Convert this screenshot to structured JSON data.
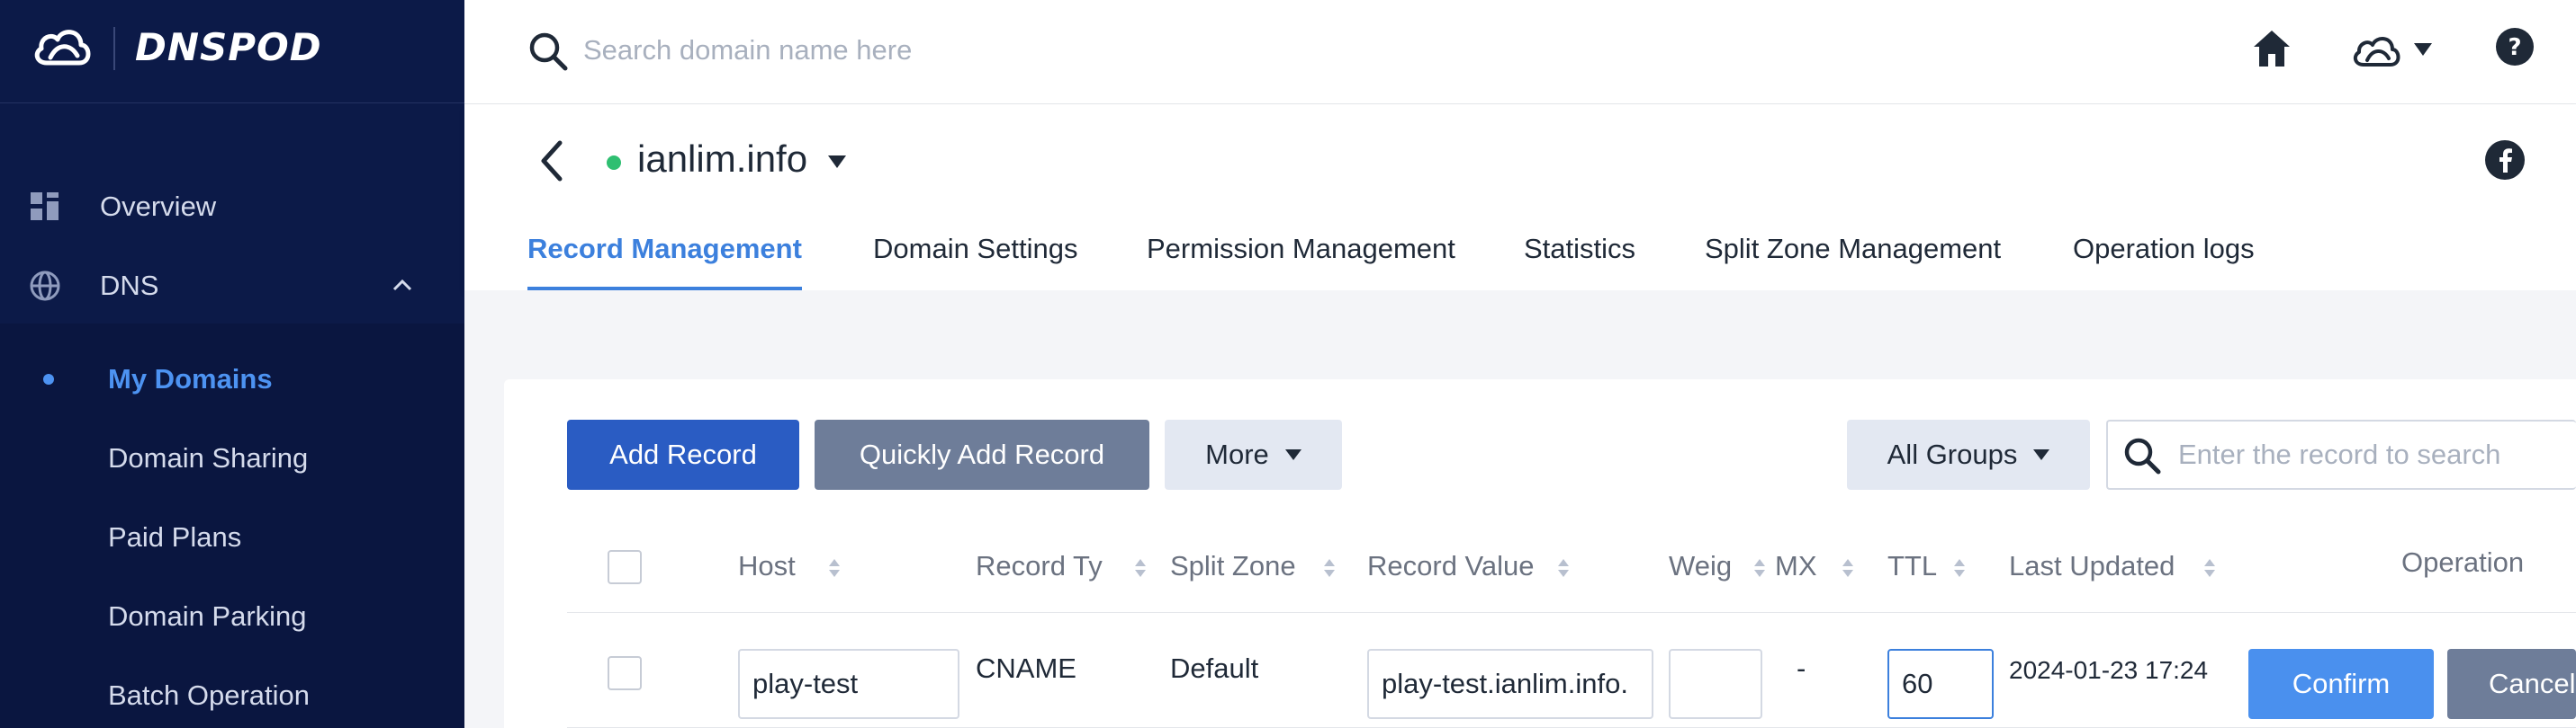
{
  "brand": {
    "name": "DNSPOD"
  },
  "sidebar": {
    "items": [
      {
        "label": "Overview",
        "icon": "grid-icon"
      },
      {
        "label": "DNS",
        "icon": "globe-icon"
      }
    ],
    "subitems": [
      {
        "label": "My Domains",
        "active": true
      },
      {
        "label": "Domain Sharing"
      },
      {
        "label": "Paid Plans"
      },
      {
        "label": "Domain Parking"
      },
      {
        "label": "Batch Operation"
      }
    ]
  },
  "topbar": {
    "search_placeholder": "Search domain name here",
    "icons": [
      "search-icon",
      "home-icon",
      "cloud-icon",
      "help-icon"
    ]
  },
  "domain": {
    "name": "ianlim.info",
    "status_color": "#2fbf71"
  },
  "tabs": [
    {
      "label": "Record Management",
      "active": true
    },
    {
      "label": "Domain Settings"
    },
    {
      "label": "Permission Management"
    },
    {
      "label": "Statistics"
    },
    {
      "label": "Split Zone Management"
    },
    {
      "label": "Operation logs"
    }
  ],
  "toolbar": {
    "add_record": "Add Record",
    "quick_add": "Quickly Add Record",
    "more": "More",
    "groups": "All Groups",
    "record_search_placeholder": "Enter the record to search"
  },
  "table": {
    "headers": {
      "host": "Host",
      "record_type": "Record Ty",
      "split_zone": "Split Zone",
      "record_value": "Record Value",
      "weight": "Weig",
      "mx": "MX",
      "ttl": "TTL",
      "last_updated": "Last Updated",
      "operation": "Operation"
    },
    "rows": [
      {
        "host": "play-test",
        "record_type": "CNAME",
        "split_zone": "Default",
        "record_value": "play-test.ianlim.info.",
        "weight": "",
        "mx": "-",
        "ttl": "60",
        "last_updated": "2024-01-23 17:24",
        "confirm": "Confirm",
        "cancel": "Cancel"
      }
    ]
  },
  "colors": {
    "sidebar_bg": "#0c1a48",
    "accent": "#3c80dd",
    "primary_button": "#2a5cc3"
  }
}
